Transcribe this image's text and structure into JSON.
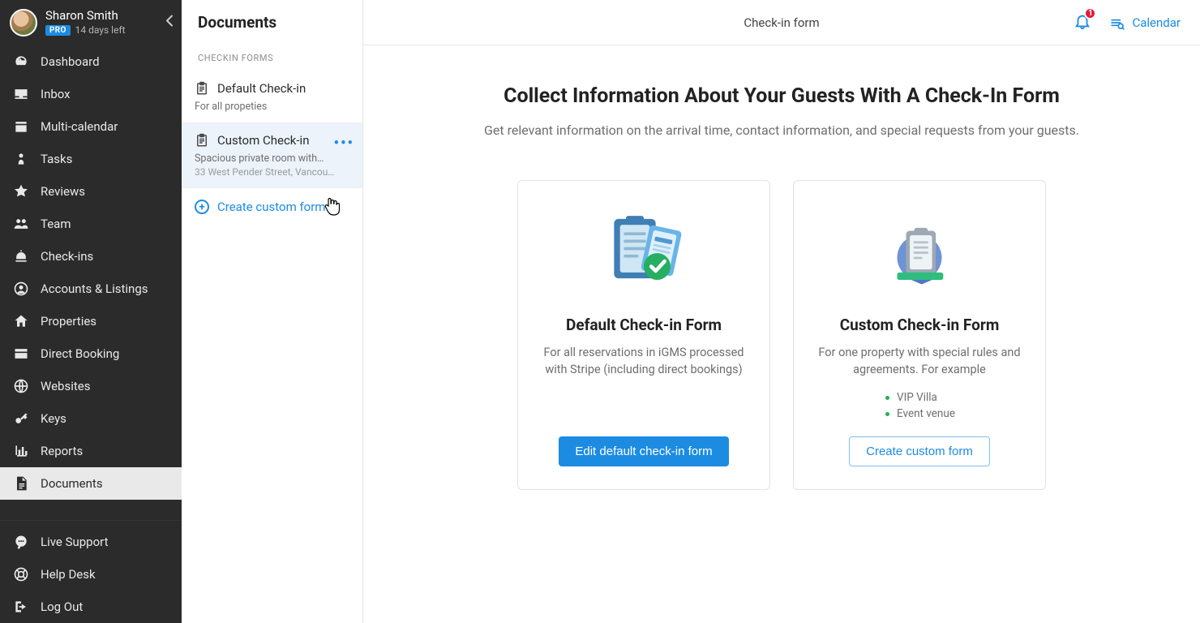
{
  "user": {
    "name": "Sharon Smith",
    "badge": "PRO",
    "trial": "14 days left"
  },
  "nav": {
    "items": [
      {
        "id": "dashboard",
        "label": "Dashboard",
        "icon": "gauge"
      },
      {
        "id": "inbox",
        "label": "Inbox",
        "icon": "tray"
      },
      {
        "id": "multi-calendar",
        "label": "Multi-calendar",
        "icon": "calendar"
      },
      {
        "id": "tasks",
        "label": "Tasks",
        "icon": "pawn"
      },
      {
        "id": "reviews",
        "label": "Reviews",
        "icon": "star"
      },
      {
        "id": "team",
        "label": "Team",
        "icon": "users"
      },
      {
        "id": "check-ins",
        "label": "Check-ins",
        "icon": "bell"
      },
      {
        "id": "accounts",
        "label": "Accounts & Listings",
        "icon": "usercircle"
      },
      {
        "id": "properties",
        "label": "Properties",
        "icon": "home"
      },
      {
        "id": "direct-booking",
        "label": "Direct Booking",
        "icon": "window"
      },
      {
        "id": "websites",
        "label": "Websites",
        "icon": "globe"
      },
      {
        "id": "keys",
        "label": "Keys",
        "icon": "key"
      },
      {
        "id": "reports",
        "label": "Reports",
        "icon": "chart"
      },
      {
        "id": "documents",
        "label": "Documents",
        "icon": "doc",
        "active": true
      }
    ],
    "bottom": [
      {
        "id": "live-support",
        "label": "Live Support",
        "icon": "chat"
      },
      {
        "id": "help-desk",
        "label": "Help Desk",
        "icon": "lifebuoy"
      },
      {
        "id": "log-out",
        "label": "Log Out",
        "icon": "logout"
      }
    ]
  },
  "doc_panel": {
    "title": "Documents",
    "section_label": "CHECKIN FORMS",
    "forms": [
      {
        "id": "default",
        "title": "Default Check-in",
        "sub": "For all propeties",
        "selected": false
      },
      {
        "id": "custom",
        "title": "Custom Check-in",
        "sub": "Spacious private room with…",
        "sub2": "33 West Pender Street, Vancou…",
        "selected": true,
        "has_more": true
      }
    ],
    "create_link": "Create custom form"
  },
  "topbar": {
    "title": "Check-in form",
    "notifications_count": "1",
    "calendar_label": "Calendar"
  },
  "hero": {
    "title": "Collect Information About Your Guests With A Check-In Form",
    "subtitle": "Get relevant information on the arrival time, contact information, and special requests from your guests."
  },
  "cards": {
    "default": {
      "title": "Default Check-in Form",
      "desc": "For all reservations in iGMS processed with Stripe (including direct bookings)",
      "button": "Edit default check-in form"
    },
    "custom": {
      "title": "Custom Check-in Form",
      "desc": "For one property with special rules and agreements. For example",
      "examples": [
        "VIP Villa",
        "Event venue"
      ],
      "button": "Create custom form"
    }
  },
  "colors": {
    "accent": "#1c8ce3",
    "sidebar_bg": "#2b2b2b"
  }
}
